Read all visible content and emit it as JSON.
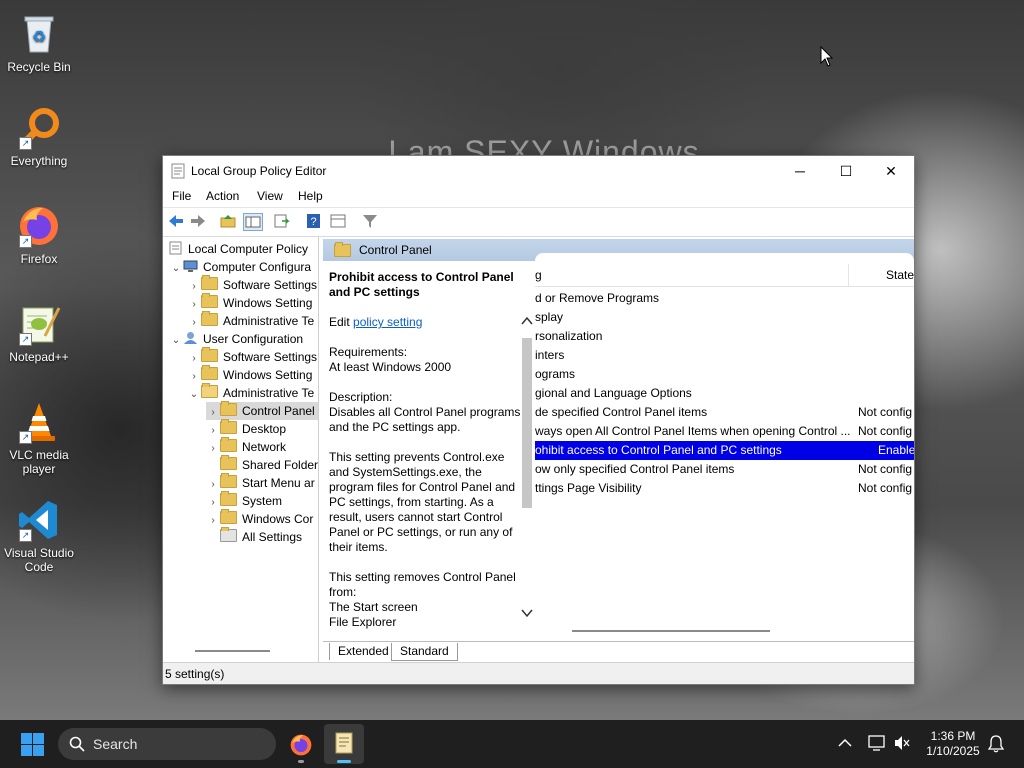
{
  "desktop": {
    "wallpaper_text": "I am SEXY Windows",
    "icons": [
      {
        "label": "Recycle Bin"
      },
      {
        "label": "Everything"
      },
      {
        "label": "Firefox"
      },
      {
        "label": "Notepad++"
      },
      {
        "label": "VLC media player"
      },
      {
        "label": "Visual Studio Code"
      }
    ]
  },
  "window": {
    "title": "Local Group Policy Editor",
    "buttons": {
      "minimize": "─",
      "maximize": "☐",
      "close": "✕"
    },
    "menu": [
      "File",
      "Action",
      "View",
      "Help"
    ],
    "tree": [
      {
        "label": "Local Computer Policy"
      },
      {
        "label": "Computer Configura"
      },
      {
        "label": "Software Settings"
      },
      {
        "label": "Windows Setting"
      },
      {
        "label": "Administrative Te"
      },
      {
        "label": "User Configuration"
      },
      {
        "label": "Software Settings"
      },
      {
        "label": "Windows Setting"
      },
      {
        "label": "Administrative Te"
      },
      {
        "label": "Control Panel"
      },
      {
        "label": "Desktop"
      },
      {
        "label": "Network"
      },
      {
        "label": "Shared Folder"
      },
      {
        "label": "Start Menu ar"
      },
      {
        "label": "System"
      },
      {
        "label": "Windows Cor"
      },
      {
        "label": "All Settings"
      }
    ],
    "pane_title": "Control Panel",
    "description": {
      "heading": "Prohibit access to Control Panel and PC settings",
      "edit_prefix": "Edit ",
      "edit_link": "policy setting",
      "requirements_label": "Requirements:",
      "requirements_value": "At least Windows 2000",
      "description_label": "Description:",
      "description_text": "Disables all Control Panel programs and the PC settings app.",
      "paragraph2": "This setting prevents Control.exe and SystemSettings.exe, the program files for Control Panel and PC settings, from starting. As a result, users cannot start Control Panel or PC settings, or run any of their items.",
      "paragraph3_label": "This setting removes Control Panel from:",
      "paragraph3_line1": "The Start screen",
      "paragraph3_line2": "File Explorer"
    },
    "list": {
      "header_name": "g",
      "header_state": "State",
      "rows": [
        {
          "name": "d or Remove Programs",
          "state": ""
        },
        {
          "name": "splay",
          "state": ""
        },
        {
          "name": "rsonalization",
          "state": ""
        },
        {
          "name": "inters",
          "state": ""
        },
        {
          "name": "ograms",
          "state": ""
        },
        {
          "name": "gional and Language Options",
          "state": ""
        },
        {
          "name": "de specified Control Panel items",
          "state": "Not config"
        },
        {
          "name": "ways open All Control Panel Items when opening Control ...",
          "state": "Not config"
        },
        {
          "name": "ohibit access to Control Panel and PC settings",
          "state": "Enable"
        },
        {
          "name": "ow only specified Control Panel items",
          "state": "Not config"
        },
        {
          "name": "ttings Page Visibility",
          "state": "Not config"
        }
      ]
    },
    "tabs": [
      "Extended",
      "Standard"
    ],
    "status": "5 setting(s)"
  },
  "taskbar": {
    "search_label": "Search",
    "time": "1:36 PM",
    "date": "1/10/2025"
  },
  "colors": {
    "selection": "#0000e6",
    "pane_header": "#b4c9e2",
    "taskbar": "#1f1f1f",
    "link": "#0b5fc6"
  }
}
